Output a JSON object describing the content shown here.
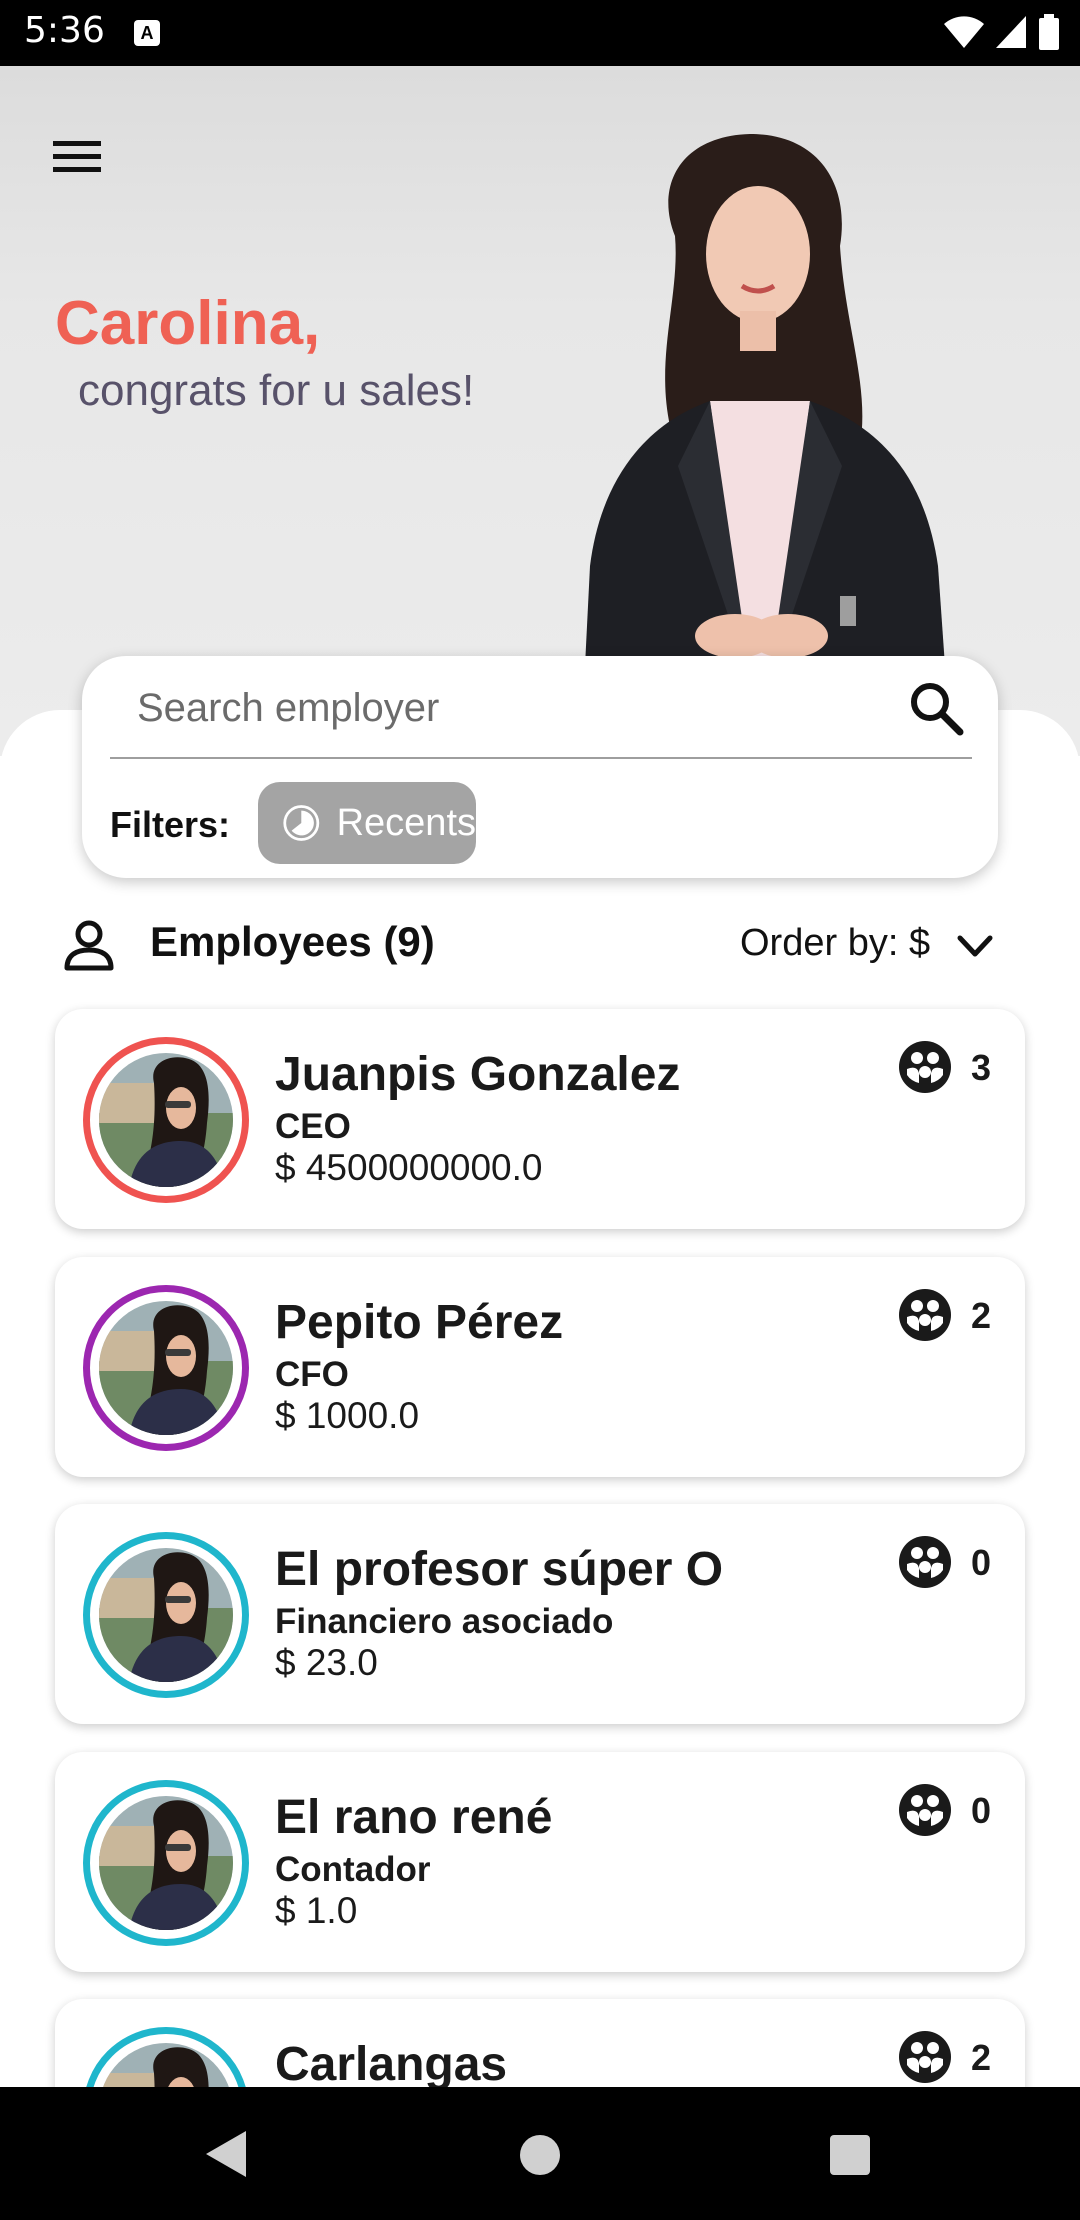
{
  "status_bar": {
    "time": "5:36",
    "notification_icon": "A"
  },
  "hero": {
    "greeting_name": "Carolina,",
    "greeting_sub": "congrats for u sales!"
  },
  "search": {
    "placeholder": "Search employer",
    "filters_label": "Filters:",
    "chip_label": "Recents"
  },
  "employees": {
    "title": "Employees (9)",
    "order_label": "Order by: $",
    "list": [
      {
        "name": "Juanpis Gonzalez",
        "role": "CEO",
        "salary": "$ 4500000000.0",
        "team": "3",
        "ring_color": "#ef5350"
      },
      {
        "name": "Pepito Pérez",
        "role": "CFO",
        "salary": "$ 1000.0",
        "team": "2",
        "ring_color": "#9c27b0"
      },
      {
        "name": "El profesor súper O",
        "role": "Financiero asociado",
        "salary": "$ 23.0",
        "team": "0",
        "ring_color": "#1fb6cc"
      },
      {
        "name": "El rano rené",
        "role": "Contador",
        "salary": "$ 1.0",
        "team": "0",
        "ring_color": "#1fb6cc"
      },
      {
        "name": "Carlangas",
        "role": "",
        "salary": "",
        "team": "2",
        "ring_color": "#1fb6cc"
      }
    ]
  },
  "icons": {
    "menu": "menu-icon",
    "search": "search-icon",
    "chip": "clock-icon",
    "person": "person-icon",
    "chevron": "chevron-down-icon",
    "team": "team-icon",
    "back": "back-icon",
    "home": "home-icon",
    "recents": "recents-icon"
  }
}
